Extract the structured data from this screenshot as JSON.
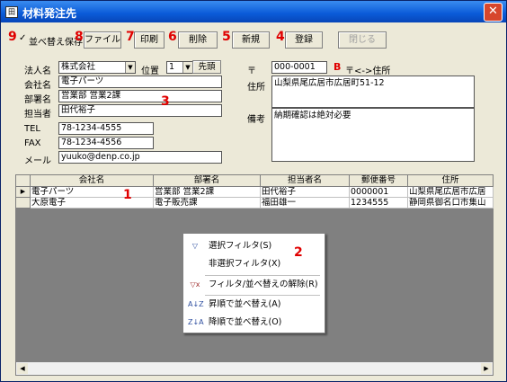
{
  "window": {
    "title": "材料発注先",
    "close_label": "✕",
    "app_icon": "田"
  },
  "toolbar": {
    "sort_save": {
      "check": "✓",
      "label": "並べ替え保存"
    },
    "file": "ファイル",
    "print": "印刷",
    "delete": "削除",
    "new": "新規",
    "register": "登録",
    "close": "閉じる"
  },
  "markers": {
    "m1": "1",
    "m2": "2",
    "m3": "3",
    "m4": "4",
    "m5": "5",
    "m6": "6",
    "m7": "7",
    "m8": "8",
    "m9": "9"
  },
  "form": {
    "corp_label": "法人名",
    "corp_value": "株式会社",
    "position_label": "位置",
    "position_value": "1",
    "position_option": "先頭",
    "company_label": "会社名",
    "company_value": "電子パーツ",
    "dept_label": "部署名",
    "dept_value": "営業部 営業2課",
    "person_label": "担当者",
    "person_value": "田代裕子",
    "tel_label": "TEL",
    "tel_value": "78-1234-4555",
    "fax_label": "FAX",
    "fax_value": "78-1234-4556",
    "mail_label": "メール",
    "mail_value": "yuuko@denp.co.jp",
    "zip_label": "〒",
    "zip_value": "000-0001",
    "zip_swap_label": "〒<->住所",
    "zip_swap_icon": "B",
    "address_label": "住所",
    "address_value": "山梨県尾広居市広居町51-12",
    "memo_label": "備考",
    "memo_value": "納期確認は絶対必要"
  },
  "grid": {
    "columns": [
      "会社名",
      "部署名",
      "担当者名",
      "郵便番号",
      "住所"
    ],
    "rows": [
      {
        "company": "電子パーツ",
        "dept": "営業部 営業2課",
        "person": "田代裕子",
        "zip": "0000001",
        "address": "山梨県尾広居市広居"
      },
      {
        "company": "大原電子",
        "dept": "電子販売課",
        "person": "福田雄一",
        "zip": "1234555",
        "address": "静岡県御名口市集山"
      }
    ],
    "current_row_marker": "▶"
  },
  "context_menu": {
    "items": [
      {
        "icon": "funnel-select-icon",
        "glyph": "▽",
        "label": "選択フィルタ(S)"
      },
      {
        "icon": "",
        "glyph": "",
        "label": "非選択フィルタ(X)"
      },
      {
        "icon": "funnel-clear-icon",
        "glyph": "▽x",
        "label": "フィルタ/並べ替えの解除(R)"
      },
      {
        "icon": "sort-ascending-icon",
        "glyph": "A↓Z",
        "label": "昇順で並べ替え(A)"
      },
      {
        "icon": "sort-descending-icon",
        "glyph": "Z↓A",
        "label": "降順で並べ替え(O)"
      }
    ]
  },
  "colors": {
    "marker": "#e00000",
    "title_bar": "#0a5ad8",
    "close_button": "#d7462c"
  }
}
